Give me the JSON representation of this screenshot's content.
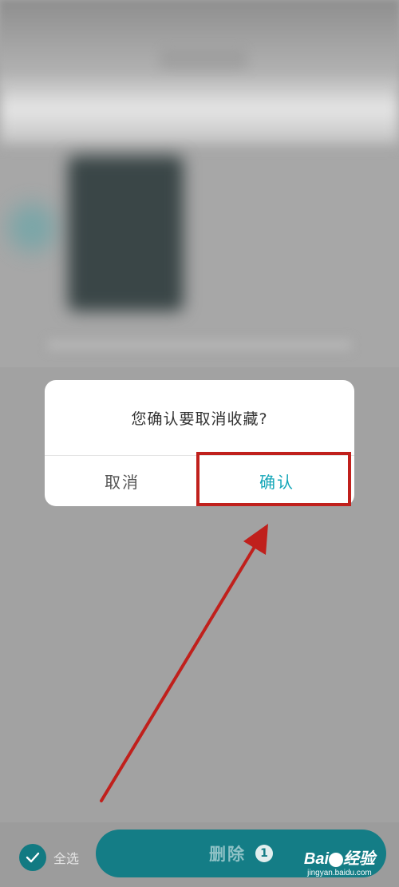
{
  "dialog": {
    "message": "您确认要取消收藏?",
    "cancel_label": "取消",
    "confirm_label": "确认"
  },
  "bottom_bar": {
    "select_all_label": "全选",
    "delete_label": "删除",
    "delete_count": "1"
  },
  "watermark": {
    "logo_text": "Bai",
    "logo_suffix": "经验",
    "url": "jingyan.baidu.com"
  },
  "colors": {
    "accent": "#14a6b8",
    "primary_button": "#147d86",
    "annotation_red": "#c0201c"
  },
  "icons": {
    "check": "check-icon",
    "paw": "baidu-paw-icon"
  }
}
